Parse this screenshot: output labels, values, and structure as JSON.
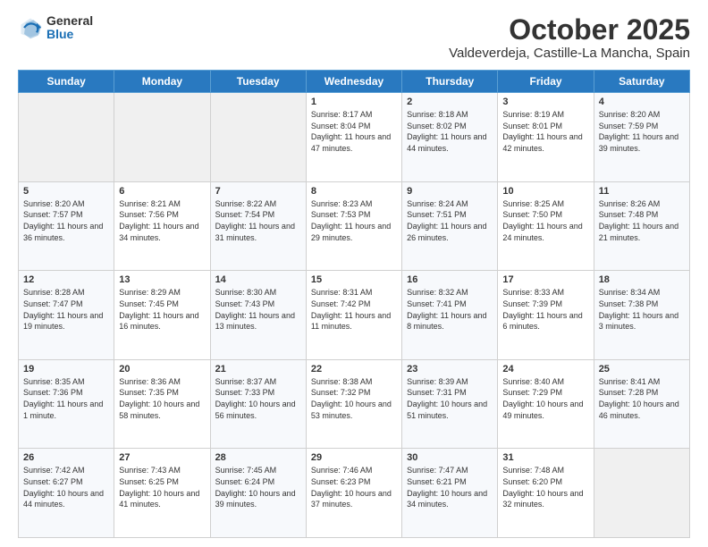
{
  "logo": {
    "general": "General",
    "blue": "Blue"
  },
  "header": {
    "month": "October 2025",
    "location": "Valdeverdeja, Castille-La Mancha, Spain"
  },
  "weekdays": [
    "Sunday",
    "Monday",
    "Tuesday",
    "Wednesday",
    "Thursday",
    "Friday",
    "Saturday"
  ],
  "weeks": [
    [
      {
        "day": "",
        "sunrise": "",
        "sunset": "",
        "daylight": ""
      },
      {
        "day": "",
        "sunrise": "",
        "sunset": "",
        "daylight": ""
      },
      {
        "day": "",
        "sunrise": "",
        "sunset": "",
        "daylight": ""
      },
      {
        "day": "1",
        "sunrise": "Sunrise: 8:17 AM",
        "sunset": "Sunset: 8:04 PM",
        "daylight": "Daylight: 11 hours and 47 minutes."
      },
      {
        "day": "2",
        "sunrise": "Sunrise: 8:18 AM",
        "sunset": "Sunset: 8:02 PM",
        "daylight": "Daylight: 11 hours and 44 minutes."
      },
      {
        "day": "3",
        "sunrise": "Sunrise: 8:19 AM",
        "sunset": "Sunset: 8:01 PM",
        "daylight": "Daylight: 11 hours and 42 minutes."
      },
      {
        "day": "4",
        "sunrise": "Sunrise: 8:20 AM",
        "sunset": "Sunset: 7:59 PM",
        "daylight": "Daylight: 11 hours and 39 minutes."
      }
    ],
    [
      {
        "day": "5",
        "sunrise": "Sunrise: 8:20 AM",
        "sunset": "Sunset: 7:57 PM",
        "daylight": "Daylight: 11 hours and 36 minutes."
      },
      {
        "day": "6",
        "sunrise": "Sunrise: 8:21 AM",
        "sunset": "Sunset: 7:56 PM",
        "daylight": "Daylight: 11 hours and 34 minutes."
      },
      {
        "day": "7",
        "sunrise": "Sunrise: 8:22 AM",
        "sunset": "Sunset: 7:54 PM",
        "daylight": "Daylight: 11 hours and 31 minutes."
      },
      {
        "day": "8",
        "sunrise": "Sunrise: 8:23 AM",
        "sunset": "Sunset: 7:53 PM",
        "daylight": "Daylight: 11 hours and 29 minutes."
      },
      {
        "day": "9",
        "sunrise": "Sunrise: 8:24 AM",
        "sunset": "Sunset: 7:51 PM",
        "daylight": "Daylight: 11 hours and 26 minutes."
      },
      {
        "day": "10",
        "sunrise": "Sunrise: 8:25 AM",
        "sunset": "Sunset: 7:50 PM",
        "daylight": "Daylight: 11 hours and 24 minutes."
      },
      {
        "day": "11",
        "sunrise": "Sunrise: 8:26 AM",
        "sunset": "Sunset: 7:48 PM",
        "daylight": "Daylight: 11 hours and 21 minutes."
      }
    ],
    [
      {
        "day": "12",
        "sunrise": "Sunrise: 8:28 AM",
        "sunset": "Sunset: 7:47 PM",
        "daylight": "Daylight: 11 hours and 19 minutes."
      },
      {
        "day": "13",
        "sunrise": "Sunrise: 8:29 AM",
        "sunset": "Sunset: 7:45 PM",
        "daylight": "Daylight: 11 hours and 16 minutes."
      },
      {
        "day": "14",
        "sunrise": "Sunrise: 8:30 AM",
        "sunset": "Sunset: 7:43 PM",
        "daylight": "Daylight: 11 hours and 13 minutes."
      },
      {
        "day": "15",
        "sunrise": "Sunrise: 8:31 AM",
        "sunset": "Sunset: 7:42 PM",
        "daylight": "Daylight: 11 hours and 11 minutes."
      },
      {
        "day": "16",
        "sunrise": "Sunrise: 8:32 AM",
        "sunset": "Sunset: 7:41 PM",
        "daylight": "Daylight: 11 hours and 8 minutes."
      },
      {
        "day": "17",
        "sunrise": "Sunrise: 8:33 AM",
        "sunset": "Sunset: 7:39 PM",
        "daylight": "Daylight: 11 hours and 6 minutes."
      },
      {
        "day": "18",
        "sunrise": "Sunrise: 8:34 AM",
        "sunset": "Sunset: 7:38 PM",
        "daylight": "Daylight: 11 hours and 3 minutes."
      }
    ],
    [
      {
        "day": "19",
        "sunrise": "Sunrise: 8:35 AM",
        "sunset": "Sunset: 7:36 PM",
        "daylight": "Daylight: 11 hours and 1 minute."
      },
      {
        "day": "20",
        "sunrise": "Sunrise: 8:36 AM",
        "sunset": "Sunset: 7:35 PM",
        "daylight": "Daylight: 10 hours and 58 minutes."
      },
      {
        "day": "21",
        "sunrise": "Sunrise: 8:37 AM",
        "sunset": "Sunset: 7:33 PM",
        "daylight": "Daylight: 10 hours and 56 minutes."
      },
      {
        "day": "22",
        "sunrise": "Sunrise: 8:38 AM",
        "sunset": "Sunset: 7:32 PM",
        "daylight": "Daylight: 10 hours and 53 minutes."
      },
      {
        "day": "23",
        "sunrise": "Sunrise: 8:39 AM",
        "sunset": "Sunset: 7:31 PM",
        "daylight": "Daylight: 10 hours and 51 minutes."
      },
      {
        "day": "24",
        "sunrise": "Sunrise: 8:40 AM",
        "sunset": "Sunset: 7:29 PM",
        "daylight": "Daylight: 10 hours and 49 minutes."
      },
      {
        "day": "25",
        "sunrise": "Sunrise: 8:41 AM",
        "sunset": "Sunset: 7:28 PM",
        "daylight": "Daylight: 10 hours and 46 minutes."
      }
    ],
    [
      {
        "day": "26",
        "sunrise": "Sunrise: 7:42 AM",
        "sunset": "Sunset: 6:27 PM",
        "daylight": "Daylight: 10 hours and 44 minutes."
      },
      {
        "day": "27",
        "sunrise": "Sunrise: 7:43 AM",
        "sunset": "Sunset: 6:25 PM",
        "daylight": "Daylight: 10 hours and 41 minutes."
      },
      {
        "day": "28",
        "sunrise": "Sunrise: 7:45 AM",
        "sunset": "Sunset: 6:24 PM",
        "daylight": "Daylight: 10 hours and 39 minutes."
      },
      {
        "day": "29",
        "sunrise": "Sunrise: 7:46 AM",
        "sunset": "Sunset: 6:23 PM",
        "daylight": "Daylight: 10 hours and 37 minutes."
      },
      {
        "day": "30",
        "sunrise": "Sunrise: 7:47 AM",
        "sunset": "Sunset: 6:21 PM",
        "daylight": "Daylight: 10 hours and 34 minutes."
      },
      {
        "day": "31",
        "sunrise": "Sunrise: 7:48 AM",
        "sunset": "Sunset: 6:20 PM",
        "daylight": "Daylight: 10 hours and 32 minutes."
      },
      {
        "day": "",
        "sunrise": "",
        "sunset": "",
        "daylight": ""
      }
    ]
  ]
}
